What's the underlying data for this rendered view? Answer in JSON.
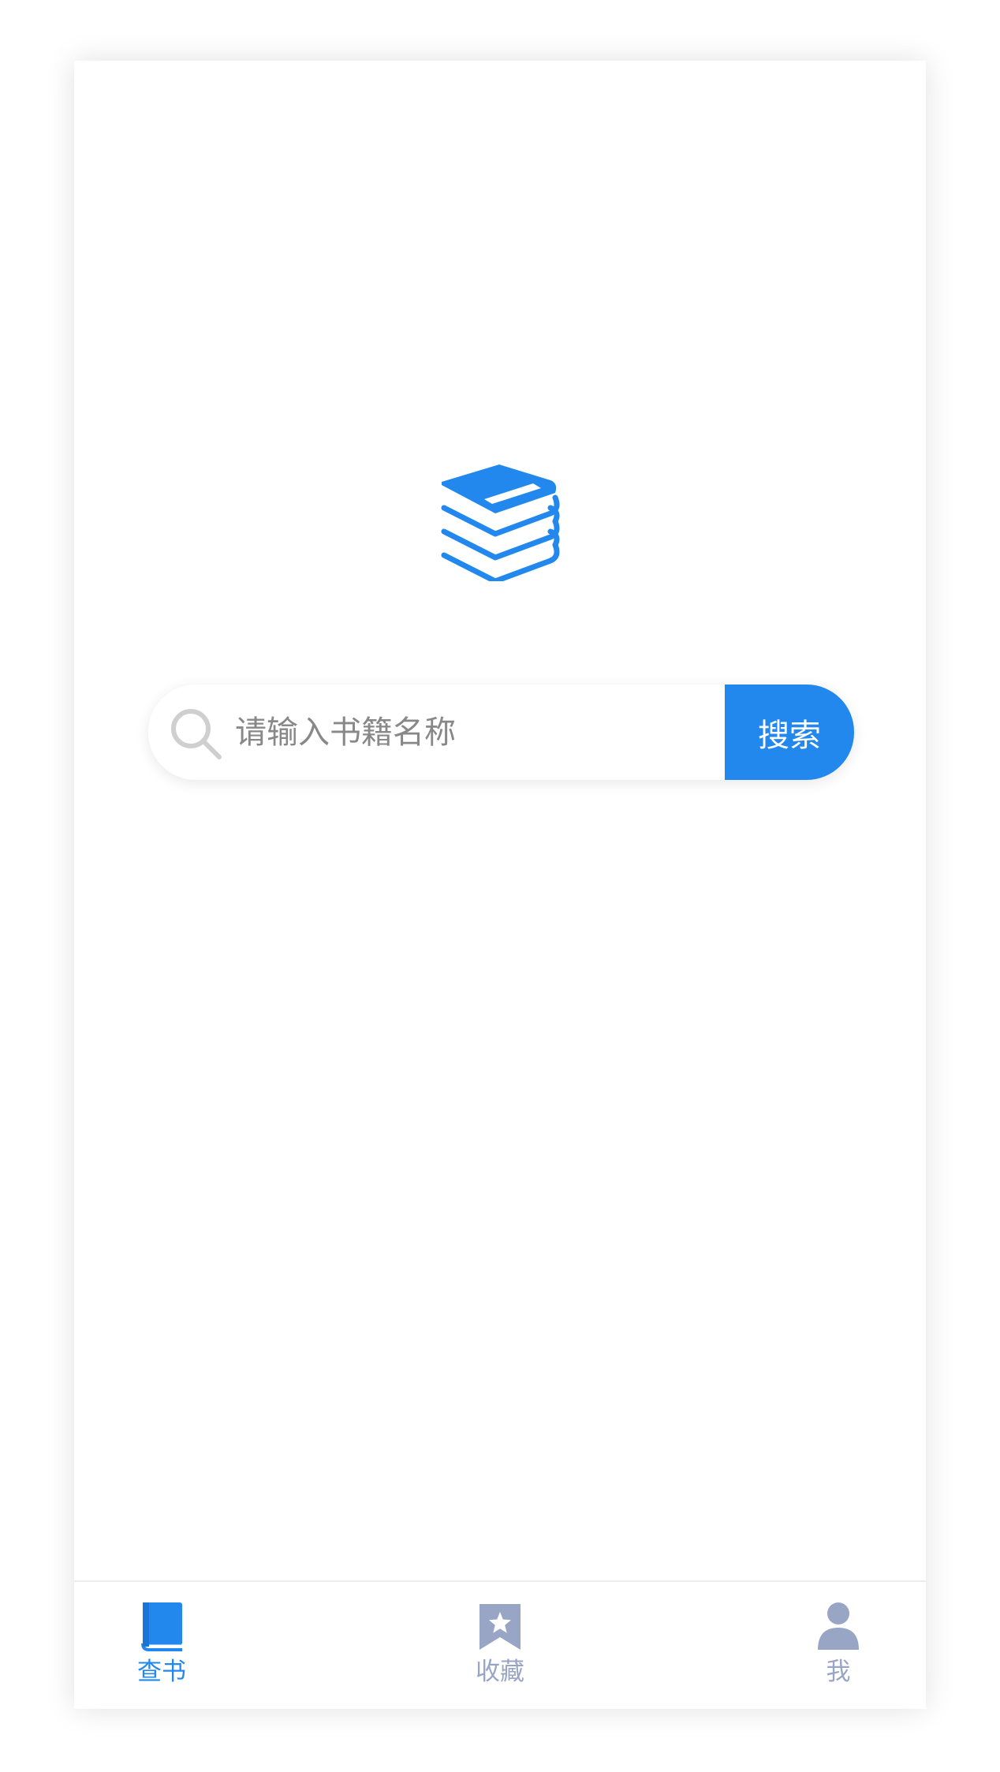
{
  "search": {
    "placeholder": "请输入书籍名称",
    "value": "",
    "button_label": "搜索"
  },
  "tabbar": {
    "tabs": [
      {
        "label": "查书",
        "icon": "book-icon",
        "active": true
      },
      {
        "label": "收藏",
        "icon": "bookmark-star-icon",
        "active": false
      },
      {
        "label": "我",
        "icon": "user-icon",
        "active": false
      }
    ]
  },
  "colors": {
    "accent": "#2288ee",
    "inactive": "#98a5c4",
    "placeholder": "#888888"
  },
  "icons": {
    "logo": "book-stack-icon",
    "search": "search-icon"
  }
}
